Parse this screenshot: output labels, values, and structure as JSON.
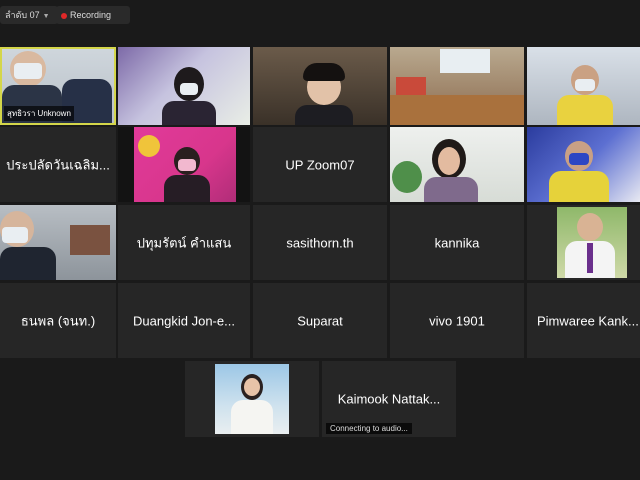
{
  "toolbar": {
    "view_label": "ลำดับ 07",
    "view_icon": "chevron-down-icon",
    "recording_label": "Recording",
    "recording_color": "#e02828"
  },
  "active_speaker_color": "#d4d64a",
  "participants": {
    "p1_label": "สุทธิวรา Unknown",
    "p6_name": "ประปลัดวันเฉลิม...",
    "p8_name": "UP Zoom07",
    "p12_name": "ปทุมรัตน์ คำแสน",
    "p13_name": "sasithorn.th",
    "p14_name": "kannika",
    "p16_name": "ธนพล (จนท.)",
    "p17_name": "Duangkid Jon-e...",
    "p18_name": "Suparat",
    "p19_name": "vivo 1901",
    "p20_name": "Pimwaree Kank...",
    "p22_name": "Kaimook Nattak...",
    "p22_status": "Connecting to audio..."
  }
}
